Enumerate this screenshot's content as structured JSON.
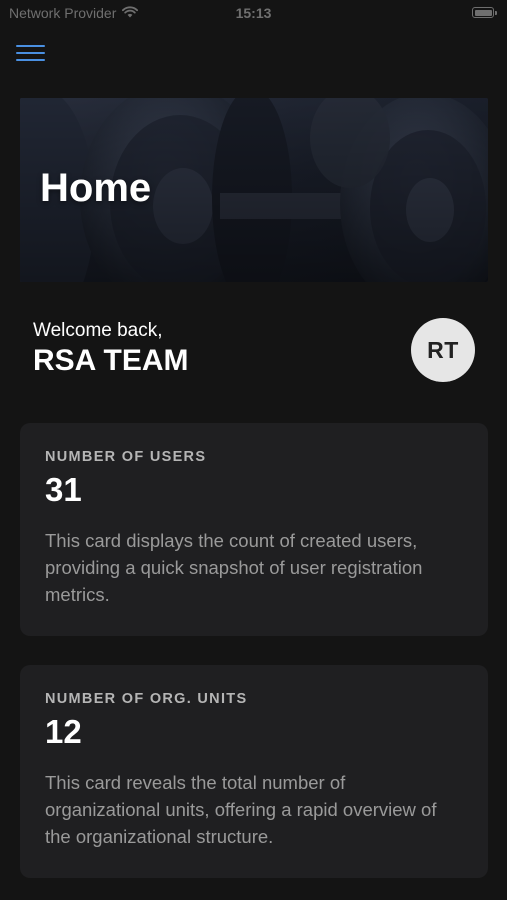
{
  "status_bar": {
    "carrier": "Network Provider",
    "time": "15:13",
    "wifi_icon": "wifi-icon",
    "battery_icon": "battery-icon"
  },
  "header": {
    "menu_icon": "hamburger-menu-icon"
  },
  "hero": {
    "title": "Home",
    "image": "dumbbell-weights-photo"
  },
  "welcome": {
    "greeting": "Welcome back,",
    "name": "RSA TEAM",
    "avatar_initials": "RT"
  },
  "cards": [
    {
      "label": "NUMBER OF USERS",
      "value": "31",
      "description": "This card displays the count of created users, providing a quick snapshot of user registration metrics."
    },
    {
      "label": "NUMBER OF ORG. UNITS",
      "value": "12",
      "description": "This card reveals the total number of organizational units, offering a rapid overview of the organizational structure."
    }
  ],
  "colors": {
    "background": "#141414",
    "card": "#1f1f21",
    "accent": "#4a90e2",
    "avatar_bg": "#e6e6e6"
  }
}
